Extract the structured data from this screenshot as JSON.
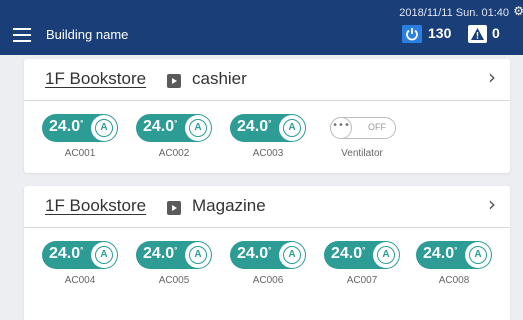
{
  "header": {
    "building_name": "Building name",
    "datetime": "2018/11/11 Sun. 01:40",
    "power_count": "130",
    "alarm_count": "0",
    "icons": {
      "menu": "hamburger-icon",
      "power": "power-icon",
      "alarm": "warning-icon",
      "settings": "gear-icon"
    },
    "colors": {
      "header_bg": "#1a3e78",
      "power_badge": "#2b7fe0",
      "on_pill": "#2c9c95"
    }
  },
  "groups": [
    {
      "zone": "1F Bookstore",
      "room": "cashier",
      "devices": [
        {
          "name": "AC001",
          "temp": "24.0",
          "mode": "A"
        },
        {
          "name": "AC002",
          "temp": "24.0",
          "mode": "A"
        },
        {
          "name": "AC003",
          "temp": "24.0",
          "mode": "A"
        },
        {
          "name": "Ventilator",
          "state": "OFF",
          "knob": "•••"
        }
      ]
    },
    {
      "zone": "1F Bookstore",
      "room": "Magazine",
      "devices": [
        {
          "name": "AC004",
          "temp": "24.0",
          "mode": "A"
        },
        {
          "name": "AC005",
          "temp": "24.0",
          "mode": "A"
        },
        {
          "name": "AC006",
          "temp": "24.0",
          "mode": "A"
        },
        {
          "name": "AC007",
          "temp": "24.0",
          "mode": "A"
        },
        {
          "name": "AC008",
          "temp": "24.0",
          "mode": "A"
        }
      ]
    }
  ],
  "degree_symbol": "°",
  "chevron": "›"
}
